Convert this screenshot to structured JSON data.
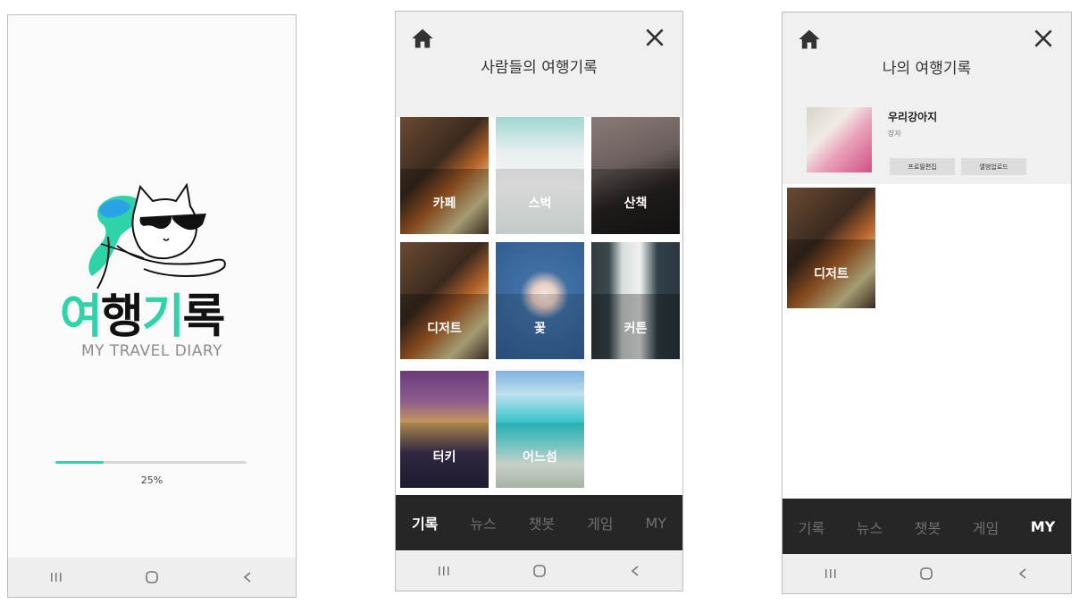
{
  "colors": {
    "accent": "#2fd3a8",
    "tabbar": "#262626",
    "header": "#f0f0f0"
  },
  "splash": {
    "logo_part1": "여행",
    "logo_part1_colors": [
      "#2fd3a8",
      "#111111"
    ],
    "logo_part2": "기록",
    "logo_part2_colors": [
      "#2fd3a8",
      "#111111"
    ],
    "logo_subtitle": "MY TRAVEL DIARY",
    "progress_percent": 25,
    "progress_text": "25%"
  },
  "system_nav": {
    "icons": [
      "recent-apps-icon",
      "home-circle-icon",
      "back-icon"
    ]
  },
  "feed": {
    "title": "사람들의 여행기록",
    "tiles": [
      {
        "label": "카페"
      },
      {
        "label": "스벅"
      },
      {
        "label": "산책"
      },
      {
        "label": "디저트"
      },
      {
        "label": "꽃"
      },
      {
        "label": "커튼"
      },
      {
        "label": "터키"
      },
      {
        "label": "어느섬"
      }
    ]
  },
  "tabs": [
    "기록",
    "뉴스",
    "챗봇",
    "게임",
    "MY"
  ],
  "feed_active_tab": "기록",
  "my": {
    "title": "나의 여행기록",
    "profile_name": "우리강아지",
    "profile_sub": "장자",
    "edit_profile_label": "프로필편집",
    "album_upload_label": "앨범업로드",
    "tiles": [
      {
        "label": "디저트"
      }
    ],
    "active_tab": "MY"
  }
}
